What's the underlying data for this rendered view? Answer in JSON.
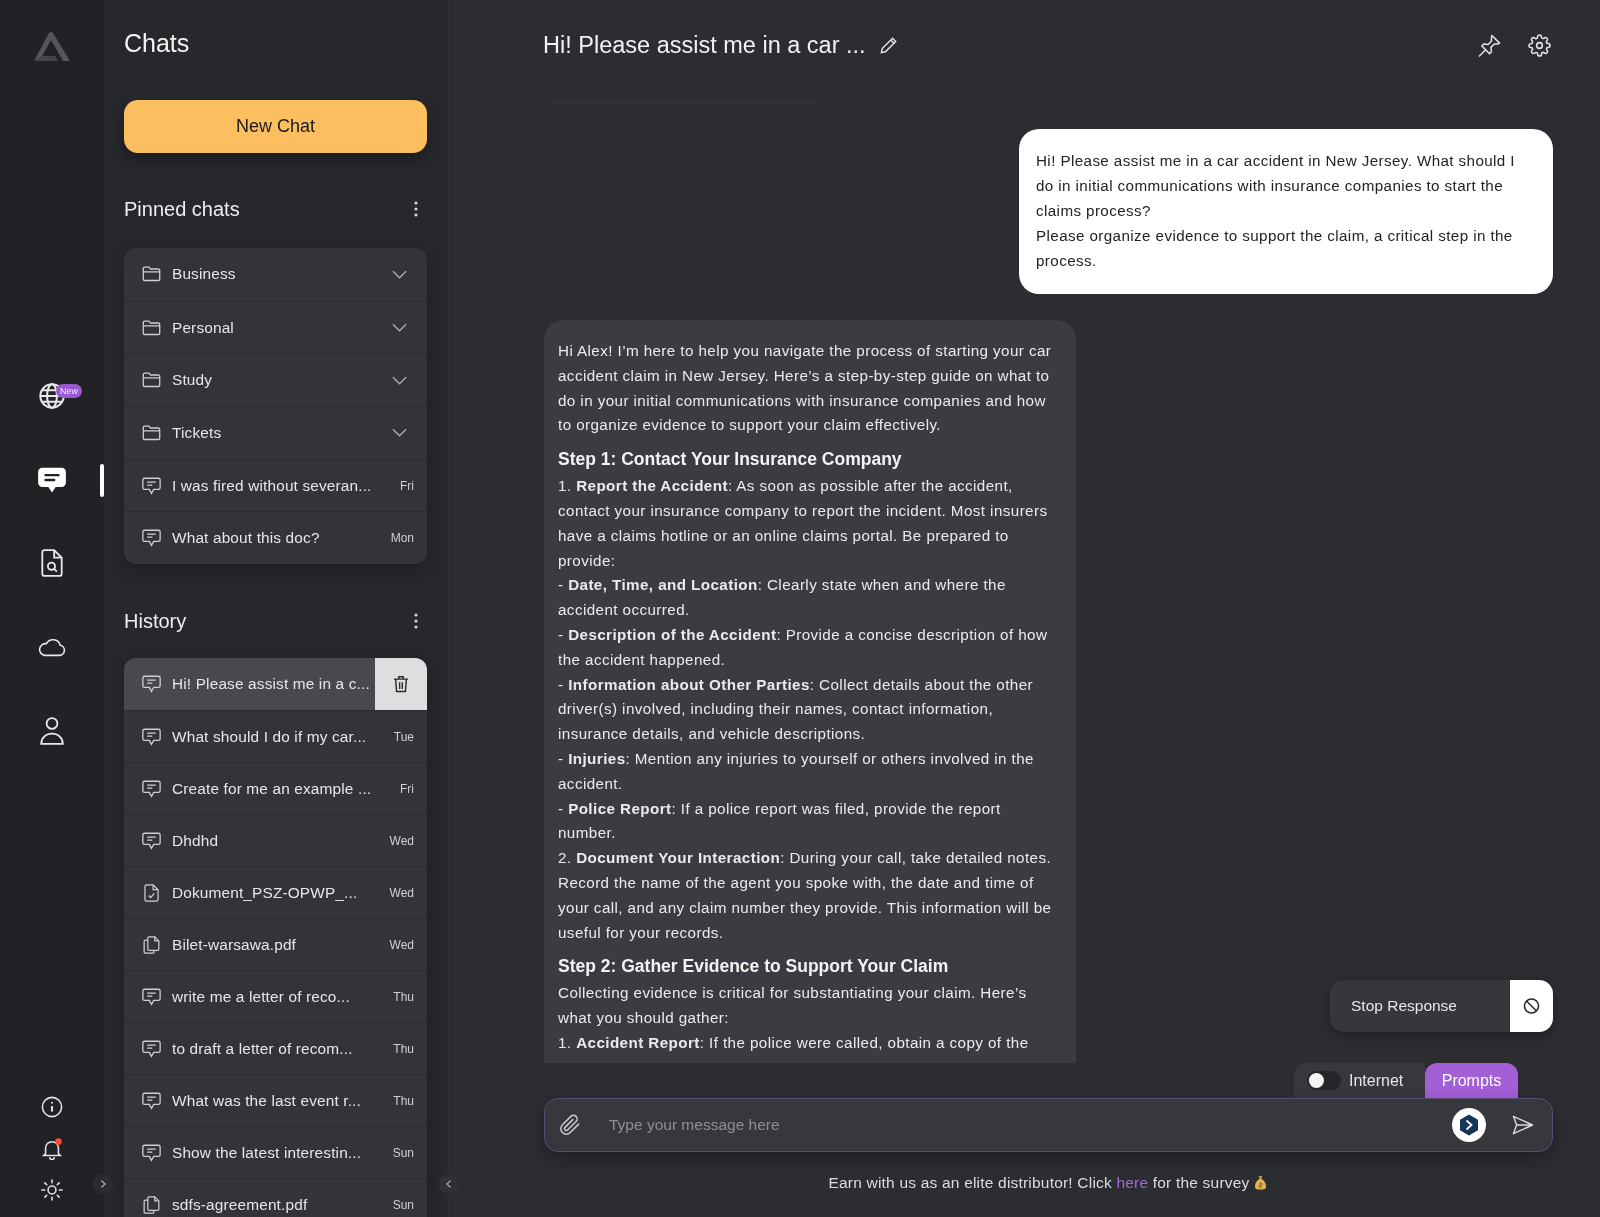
{
  "rail": {
    "nav": [
      {
        "selected": false,
        "badge": "New"
      },
      {
        "selected": true
      },
      {
        "selected": false
      },
      {
        "selected": false
      },
      {
        "selected": false
      }
    ],
    "utilities": [
      {
        "notification": false
      },
      {
        "notification": true
      },
      {
        "notification": false
      }
    ]
  },
  "sidebar": {
    "title": "Chats",
    "new_chat_button": "New Chat",
    "pinned": {
      "title": "Pinned chats",
      "items": [
        {
          "kind": "folder",
          "label": "Business",
          "expanded": false
        },
        {
          "kind": "folder",
          "label": "Personal",
          "expanded": false
        },
        {
          "kind": "folder",
          "label": "Study",
          "expanded": false
        },
        {
          "kind": "folder",
          "label": "Tickets",
          "expanded": false
        },
        {
          "kind": "chat",
          "label": "I was fired without severan...",
          "date": "Fri"
        },
        {
          "kind": "chat",
          "label": "What about this doc?",
          "date": "Mon"
        }
      ]
    },
    "history": {
      "title": "History",
      "items": [
        {
          "kind": "chat",
          "label": "Hi! Please assist me in a c...",
          "selected": true
        },
        {
          "kind": "chat",
          "label": "What should I do if my car...",
          "date": "Tue",
          "selected": false
        },
        {
          "kind": "chat",
          "label": "Create for me an example ...",
          "date": "Fri",
          "selected": false
        },
        {
          "kind": "chat",
          "label": "Dhdhd",
          "date": "Wed",
          "selected": false
        },
        {
          "kind": "document",
          "label": "Dokument_PSZ-OPWP_...",
          "date": "Wed",
          "selected": false
        },
        {
          "kind": "file",
          "label": "Bilet-warsawa.pdf",
          "date": "Wed",
          "selected": false
        },
        {
          "kind": "chat",
          "label": "write me a letter of reco...",
          "date": "Thu",
          "selected": false
        },
        {
          "kind": "chat",
          "label": "to draft a letter of recom...",
          "date": "Thu",
          "selected": false
        },
        {
          "kind": "chat",
          "label": "What was the last event r...",
          "date": "Thu",
          "selected": false
        },
        {
          "kind": "chat",
          "label": "Show the latest interestin...",
          "date": "Sun",
          "selected": false
        },
        {
          "kind": "file",
          "label": "sdfs-agreement.pdf",
          "date": "Sun",
          "selected": false
        }
      ]
    }
  },
  "chat": {
    "title": "Hi! Please assist me in a car ...",
    "messages": [
      {
        "kind": "user",
        "lines": [
          "Hi! Please assist me in a car accident in New Jersey. What should I do in initial communications with insurance companies to start the claims process?",
          "Please organize evidence to support the claim, a critical step in the process."
        ]
      },
      {
        "kind": "assistant",
        "blocks": [
          {
            "kind": "paragraph",
            "text": "Hi Alex! I’m here to help you navigate the process of starting your car accident claim in New Jersey. Here’s a step-by-step guide on what to do in your initial communications with insurance companies and how to organize evidence to support your claim effectively."
          },
          {
            "kind": "heading",
            "text": "Step 1: Contact Your Insurance Company"
          },
          {
            "kind": "list-item",
            "text": "1. **Report the Accident**: As soon as possible after the accident, contact your insurance company to report the incident. Most insurers have a claims hotline or an online claims portal. Be prepared to provide:"
          },
          {
            "kind": "list-item",
            "text": "- **Date, Time, and Location**: Clearly state when and where the accident occurred."
          },
          {
            "kind": "list-item",
            "text": "- **Description of the Accident**: Provide a concise description of how the accident happened."
          },
          {
            "kind": "list-item",
            "text": "- **Information about Other Parties**: Collect details about the other driver(s) involved, including their names, contact information, insurance details, and vehicle descriptions."
          },
          {
            "kind": "list-item",
            "text": "- **Injuries**: Mention any injuries to yourself or others involved in the accident."
          },
          {
            "kind": "list-item",
            "text": "- **Police Report**: If a police report was filed, provide the report number."
          },
          {
            "kind": "list-item",
            "text": "2. **Document Your Interaction**: During your call, take detailed notes. Record the name of the agent you spoke with, the date and time of your call, and any claim number they provide. This information will be useful for your records."
          },
          {
            "kind": "heading",
            "text": "Step 2: Gather Evidence to Support Your Claim"
          },
          {
            "kind": "paragraph",
            "text": "Collecting evidence is critical for substantiating your claim. Here’s what you should gather:"
          },
          {
            "kind": "list-item",
            "text": "1. **Accident Report**: If the police were called, obtain a copy of the"
          }
        ]
      }
    ],
    "stop_button": "Stop Response",
    "composer": {
      "internet_toggle": {
        "label": "Internet",
        "on": false
      },
      "prompts_tab": {
        "label": "Prompts",
        "selected": true
      },
      "placeholder": "Type your message here"
    },
    "footer": {
      "before_link": "Earn with us as an elite distributor! Click",
      "link": "here",
      "after_link": "for the survey"
    }
  }
}
